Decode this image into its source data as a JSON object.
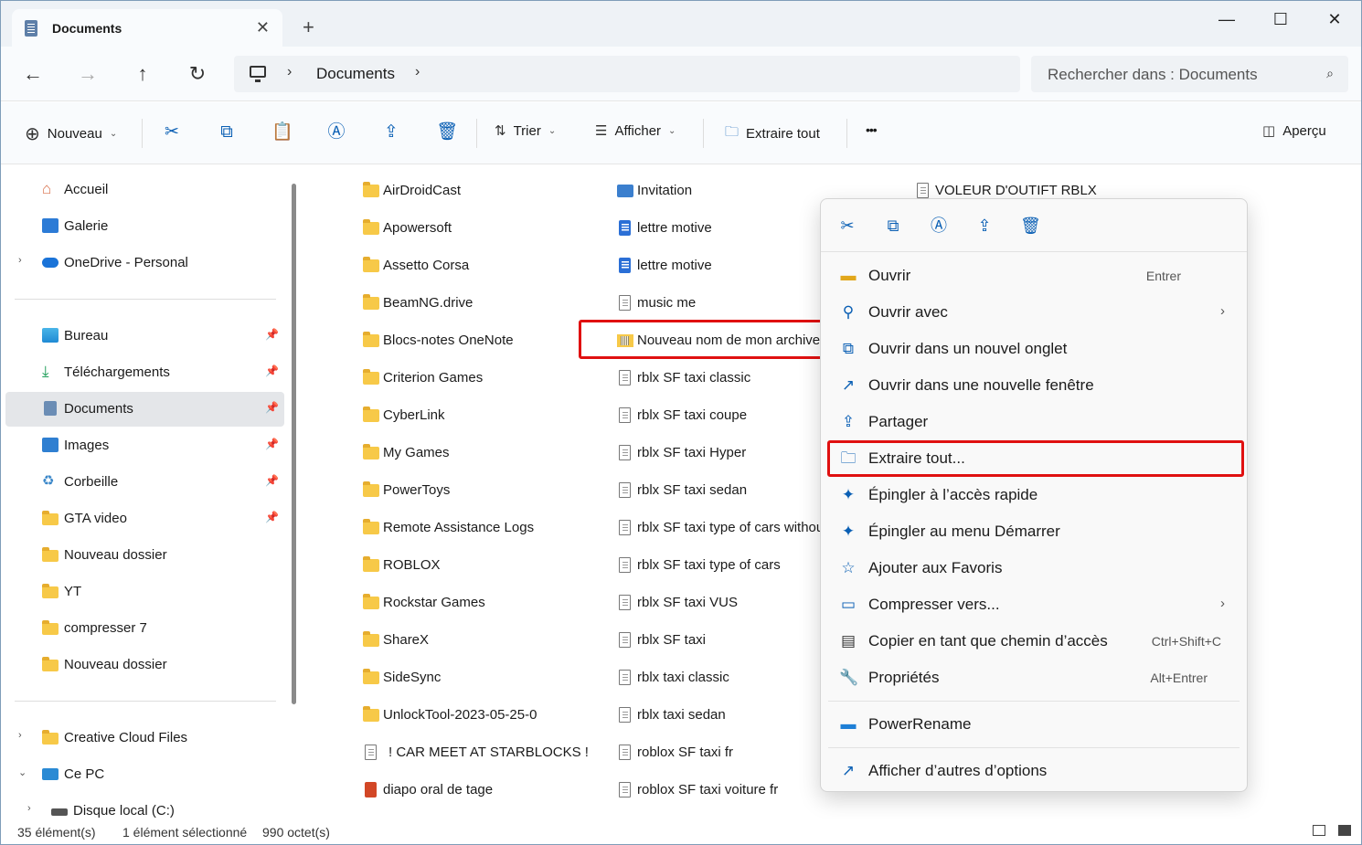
{
  "window": {
    "tab_title": "Documents",
    "tab_close": "✕",
    "new_tab": "+",
    "minimize": "—",
    "maximize": "☐",
    "close": "✕"
  },
  "address": {
    "back": "←",
    "forward": "→",
    "up": "↑",
    "refresh": "↻",
    "breadcrumb": "Documents",
    "sep": "›",
    "search_placeholder": "Rechercher dans : Documents",
    "search_icon": "⌕"
  },
  "command_bar": {
    "new_label": "Nouveau",
    "sort_label": "Trier",
    "view_label": "Afficher",
    "extract_label": "Extraire tout",
    "more_label": "•••",
    "preview_label": "Aperçu",
    "chev": "⌄"
  },
  "sidebar": {
    "items": [
      {
        "label": "Accueil",
        "icon": "home-icon"
      },
      {
        "label": "Galerie",
        "icon": "gallery-icon"
      },
      {
        "label": "OneDrive - Personal",
        "icon": "onedrive-icon"
      },
      {
        "label": "Bureau",
        "icon": "desktop-icon"
      },
      {
        "label": "Téléchargements",
        "icon": "download-icon"
      },
      {
        "label": "Documents",
        "icon": "documents-icon"
      },
      {
        "label": "Images",
        "icon": "images-icon"
      },
      {
        "label": "Corbeille",
        "icon": "recycle-bin-icon"
      },
      {
        "label": "GTA video",
        "icon": "folder-icon"
      },
      {
        "label": "Nouveau dossier",
        "icon": "folder-icon"
      },
      {
        "label": "YT",
        "icon": "folder-icon"
      },
      {
        "label": "compresser 7",
        "icon": "folder-icon"
      },
      {
        "label": "Nouveau dossier",
        "icon": "folder-icon"
      },
      {
        "label": "Creative Cloud Files",
        "icon": "creative-cloud-icon"
      },
      {
        "label": "Ce PC",
        "icon": "pc-icon"
      },
      {
        "label": "Disque local (C:)",
        "icon": "drive-icon"
      }
    ],
    "chev_right": "›",
    "chev_down": "⌄",
    "pin": "📌"
  },
  "files": {
    "col1": [
      "AirDroidCast",
      "Apowersoft",
      "Assetto Corsa",
      "BeamNG.drive",
      "Blocs-notes OneNote",
      "Criterion Games",
      "CyberLink",
      "My Games",
      "PowerToys",
      "Remote Assistance Logs",
      "ROBLOX",
      "Rockstar Games",
      "ShareX",
      "SideSync",
      "UnlockTool-2023-05-25-0",
      "! CAR MEET AT STARBLOCKS !",
      "diapo oral de tage"
    ],
    "col2": [
      "Invitation",
      "lettre motive",
      "lettre motive",
      "music me",
      "Nouveau nom de mon archive",
      "rblx SF taxi  classic",
      "rblx SF taxi coupe",
      "rblx SF taxi Hyper",
      "rblx SF taxi sedan",
      "rblx SF taxi type of cars without",
      "rblx SF taxi type of cars",
      "rblx SF taxi VUS",
      "rblx SF taxi",
      "rblx taxi classic",
      "rblx taxi sedan",
      "roblox SF taxi fr",
      "roblox SF taxi voiture fr"
    ],
    "col3": [
      "VOLEUR D'OUTIFT RBLX"
    ]
  },
  "context_menu": {
    "items": [
      {
        "label": "Ouvrir",
        "shortcut": "Entrer",
        "icon": "folder-open-icon"
      },
      {
        "label": "Ouvrir avec",
        "shortcut": "",
        "icon": "open-with-icon",
        "submenu": "›"
      },
      {
        "label": "Ouvrir dans un nouvel onglet",
        "shortcut": "",
        "icon": "new-tab-icon"
      },
      {
        "label": "Ouvrir dans une nouvelle fenêtre",
        "shortcut": "",
        "icon": "new-window-icon"
      },
      {
        "label": "Partager",
        "shortcut": "",
        "icon": "share-icon"
      },
      {
        "label": "Extraire tout...",
        "shortcut": "",
        "icon": "extract-icon"
      },
      {
        "label": "Épingler à l’accès rapide",
        "shortcut": "",
        "icon": "pin-icon"
      },
      {
        "label": "Épingler au menu Démarrer",
        "shortcut": "",
        "icon": "pin-icon"
      },
      {
        "label": "Ajouter aux Favoris",
        "shortcut": "",
        "icon": "star-icon"
      },
      {
        "label": "Compresser vers...",
        "shortcut": "",
        "icon": "compress-icon",
        "submenu": "›"
      },
      {
        "label": "Copier en tant que chemin d’accès",
        "shortcut": "Ctrl+Shift+C",
        "icon": "copy-path-icon"
      },
      {
        "label": "Propriétés",
        "shortcut": "Alt+Entrer",
        "icon": "wrench-icon"
      },
      {
        "label": "PowerRename",
        "shortcut": "",
        "icon": "powerrename-icon"
      },
      {
        "label": "Afficher d’autres d’options",
        "shortcut": "",
        "icon": "more-options-icon"
      }
    ]
  },
  "status": {
    "count": "35 élément(s)",
    "selected": "1 élément sélectionné",
    "size": "990 octet(s)"
  },
  "colors": {
    "accent": "#0a5fb4",
    "highlight_red": "#e01010",
    "folder": "#f7c948"
  }
}
